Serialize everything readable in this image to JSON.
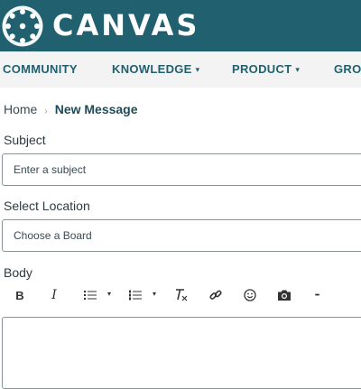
{
  "header": {
    "logo_text": "CANVAS"
  },
  "nav": {
    "items": [
      {
        "label": "COMMUNITY",
        "dropdown": false
      },
      {
        "label": "KNOWLEDGE",
        "dropdown": true
      },
      {
        "label": "PRODUCT",
        "dropdown": true
      },
      {
        "label": "GRO",
        "dropdown": false
      }
    ],
    "caret": "▾"
  },
  "breadcrumb": {
    "home": "Home",
    "separator": "›",
    "current": "New Message"
  },
  "form": {
    "subject_label": "Subject",
    "subject_placeholder": "Enter a subject",
    "location_label": "Select Location",
    "location_value": "Choose a Board",
    "body_label": "Body"
  },
  "toolbar": {
    "bold": "B",
    "italic": "I",
    "caret": "▾",
    "more": "•••"
  },
  "colors": {
    "brand": "#20606f",
    "nav_bg": "#f3f3f3",
    "border": "#8b9598"
  }
}
